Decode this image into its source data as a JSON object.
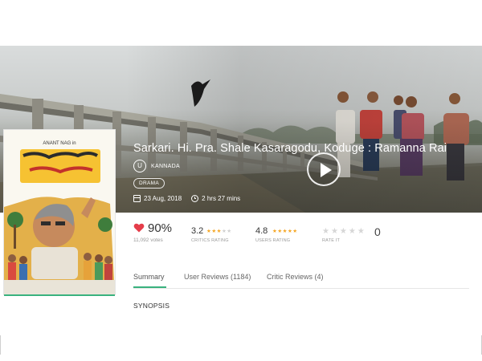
{
  "movie": {
    "title": "Sarkari. Hi. Pra. Shale Kasaragodu, Koduge : Ramanna Rai",
    "language_icon_letter": "U",
    "language": "KANNADA",
    "genre": "DRAMA",
    "release_date": "23 Aug, 2018",
    "duration": "2 hrs 27 mins"
  },
  "ratings": {
    "audience_percent": "90%",
    "votes": "11,092 votes",
    "critics": {
      "value": "3.2",
      "label": "CRITICS RATING",
      "stars": 3.2
    },
    "users": {
      "value": "4.8",
      "label": "USERS RATING",
      "stars": 4.8
    },
    "rate_it": {
      "label": "RATE IT",
      "count": "0"
    }
  },
  "tabs": [
    {
      "label": "Summary",
      "active": true
    },
    {
      "label": "User Reviews (1184)"
    },
    {
      "label": "Critic Reviews (4)"
    }
  ],
  "section_heading": "SYNOPSIS",
  "colors": {
    "accent": "#39b27e",
    "heart": "#e53d4a",
    "star": "#f5a623"
  },
  "icons": {
    "play": "play-icon",
    "language": "u-certificate-icon",
    "calendar": "calendar-icon",
    "clock": "clock-icon",
    "heart": "heart-icon"
  }
}
